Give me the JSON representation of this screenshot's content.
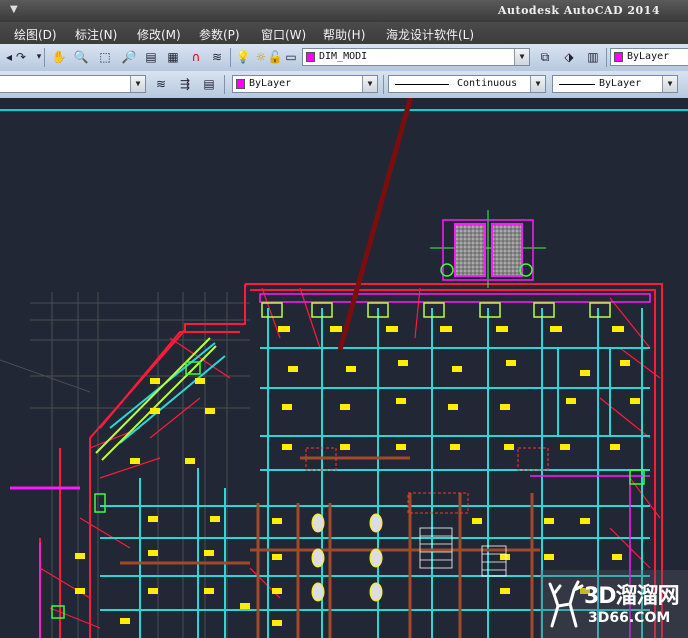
{
  "window": {
    "title": "Autodesk AutoCAD 2014"
  },
  "menu": [
    {
      "label": "绘图(D)"
    },
    {
      "label": "标注(N)"
    },
    {
      "label": "修改(M)"
    },
    {
      "label": "参数(P)"
    },
    {
      "label": "窗口(W)"
    },
    {
      "label": "帮助(H)"
    },
    {
      "label": "海龙设计软件(L)"
    }
  ],
  "toolbar": {
    "layer_name": "DIM_MODI",
    "color_top": "ByLayer",
    "color": "ByLayer",
    "linetype": "Continuous",
    "lineweight": "ByLayer"
  },
  "watermark": {
    "main": "3D溜溜网",
    "sub": "3D66.COM"
  },
  "colors": {
    "accent_layer": "#ff00ff",
    "highlight_arrow": "#7a0e0e",
    "canvas_bg": "#212734"
  }
}
